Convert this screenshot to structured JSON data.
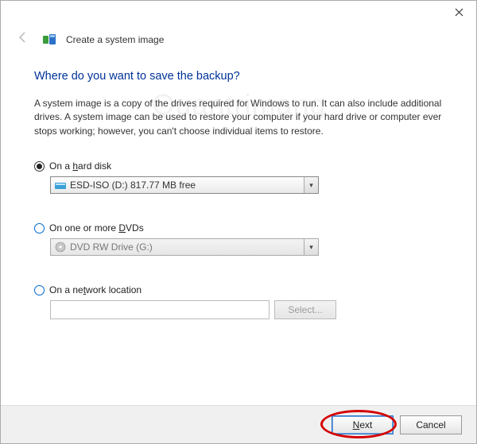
{
  "window": {
    "title": "Create a system image"
  },
  "page": {
    "heading": "Where do you want to save the backup?",
    "description": "A system image is a copy of the drives required for Windows to run. It can also include additional drives. A system image can be used to restore your computer if your hard drive or computer ever stops working; however, you can't choose individual items to restore."
  },
  "options": {
    "hard_disk": {
      "label_pre": "On a ",
      "label_ul": "h",
      "label_post": "ard disk",
      "selected_drive": "ESD-ISO (D:)  817.77 MB free",
      "checked": true
    },
    "dvd": {
      "label_pre": "On one or more ",
      "label_ul": "D",
      "label_post": "VDs",
      "selected_drive": "DVD RW Drive (G:)",
      "checked": false
    },
    "network": {
      "label_pre": "On a ne",
      "label_ul": "t",
      "label_post": "work location",
      "path": "",
      "select_button": "Select...",
      "checked": false
    }
  },
  "footer": {
    "next_ul": "N",
    "next_post": "ext",
    "cancel": "Cancel"
  },
  "watermark": "Quantrimang"
}
